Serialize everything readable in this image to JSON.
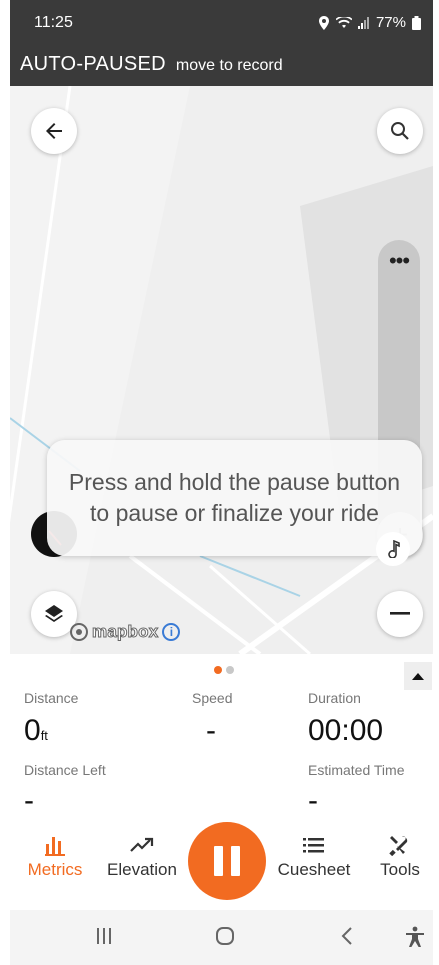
{
  "status_bar": {
    "time": "11:25",
    "battery": "77%"
  },
  "header": {
    "title": "AUTO-PAUSED",
    "subtitle": "move to record"
  },
  "map": {
    "tooltip": "Press and hold the pause button to pause or finalize your ride",
    "attribution": "mapbox",
    "slider_menu": "•••",
    "zoom_in": "+",
    "info_glyph": "i"
  },
  "metrics": {
    "distance_label": "Distance",
    "distance_value": "0",
    "distance_unit": "ft",
    "speed_label": "Speed",
    "speed_value": "-",
    "duration_label": "Duration",
    "duration_value": "00:00",
    "distance_left_label": "Distance Left",
    "distance_left_value": "-",
    "estimated_time_label": "Estimated Time",
    "estimated_time_value": "-"
  },
  "nav": {
    "metrics": "Metrics",
    "elevation": "Elevation",
    "cuesheet": "Cuesheet",
    "tools": "Tools"
  },
  "colors": {
    "accent": "#f26b21",
    "header_bg": "#3a3a3a"
  }
}
